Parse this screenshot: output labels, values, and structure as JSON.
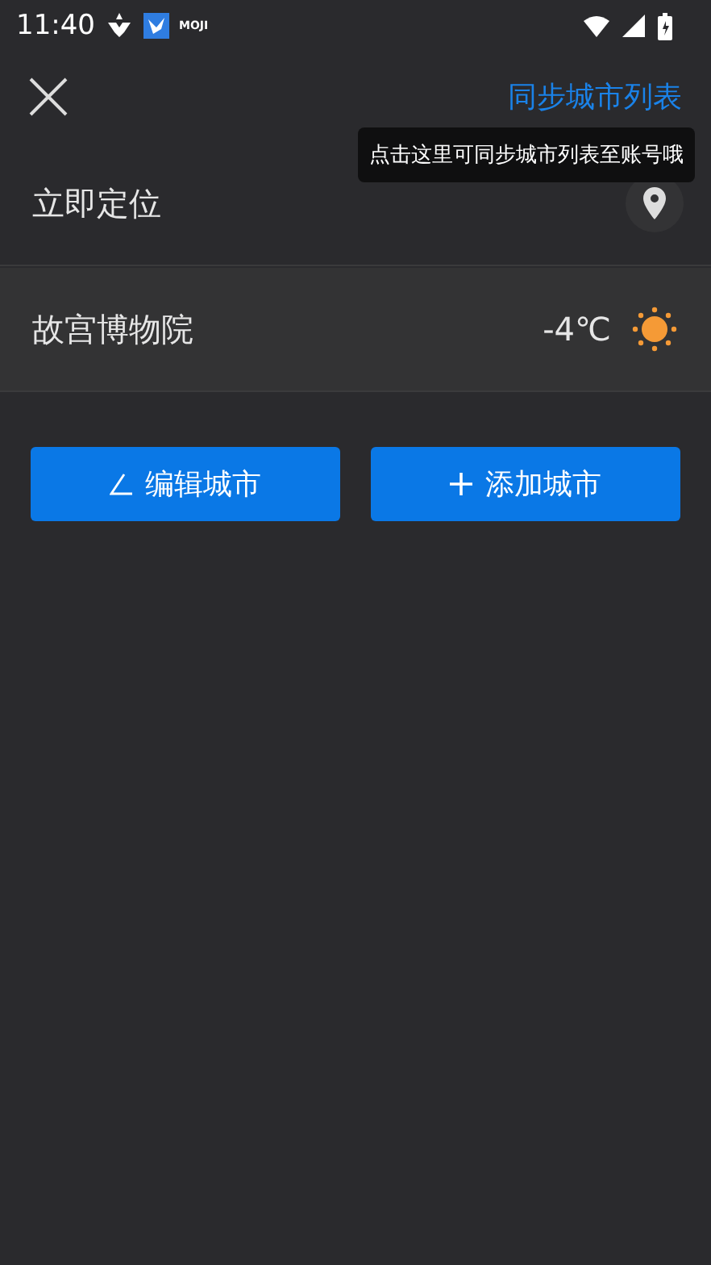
{
  "status_bar": {
    "time": "11:40",
    "app_label": "MOJI"
  },
  "header": {
    "sync_link": "同步城市列表",
    "tooltip": "点击这里可同步城市列表至账号哦"
  },
  "rows": [
    {
      "kind": "locate",
      "label": "立即定位"
    },
    {
      "kind": "city",
      "label": "故宫博物院",
      "temperature": "-4℃"
    }
  ],
  "buttons": [
    {
      "kind": "edit",
      "label": "编辑城市"
    },
    {
      "kind": "add",
      "label": "添加城市"
    }
  ]
}
